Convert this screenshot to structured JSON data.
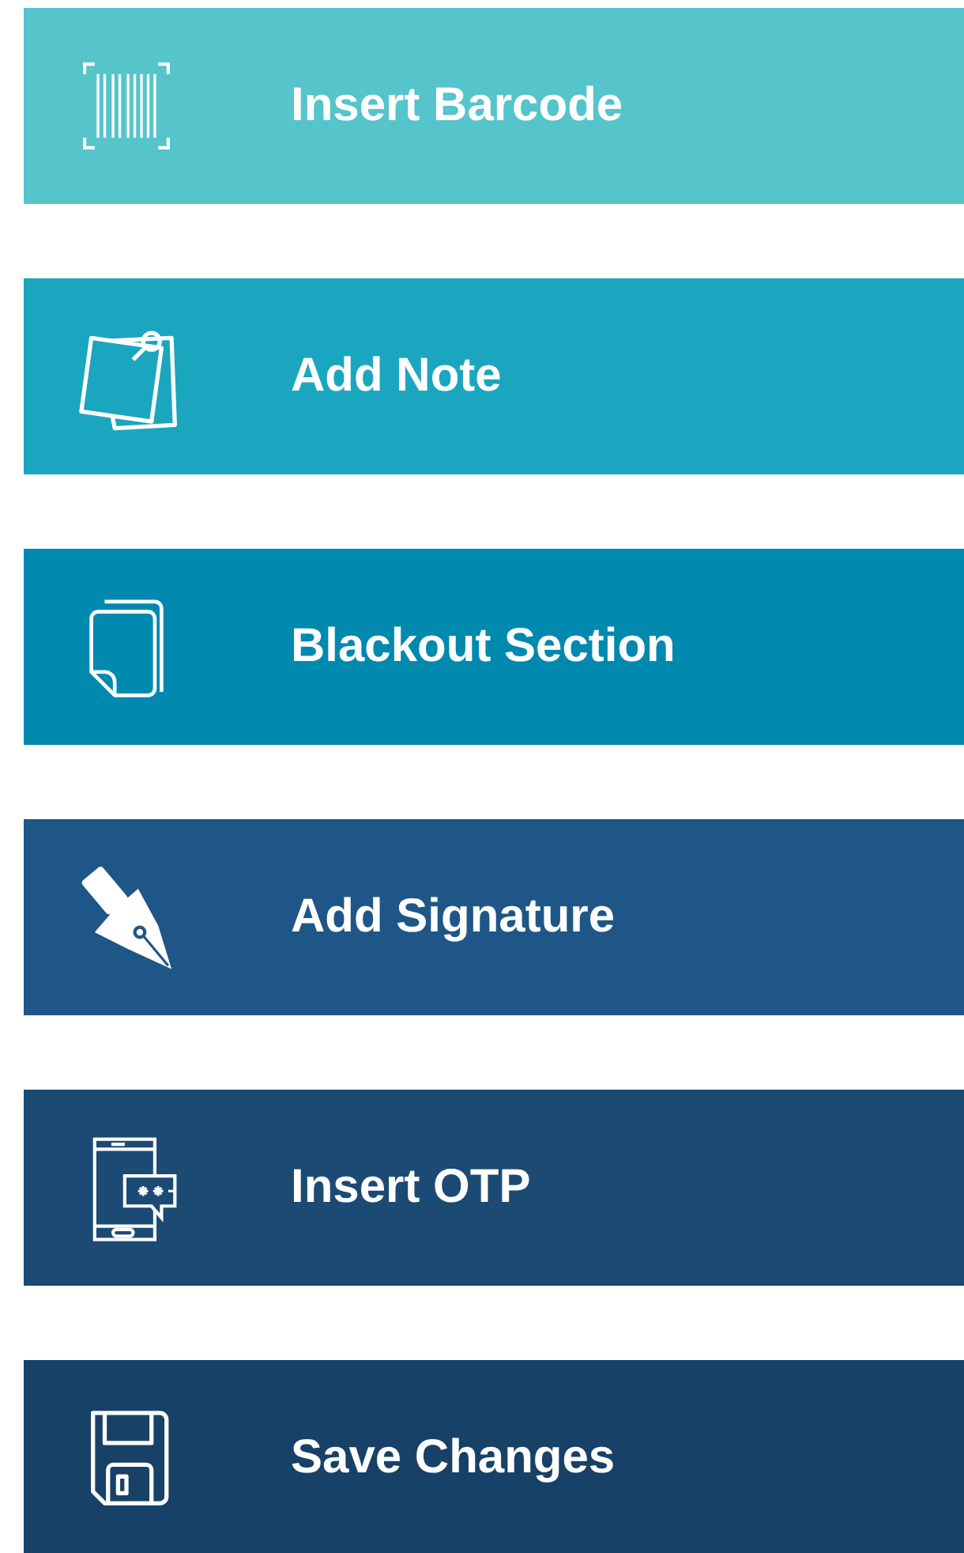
{
  "actions": [
    {
      "kind": "barcode",
      "label": "Insert Barcode",
      "color": "#55c4cb"
    },
    {
      "kind": "note",
      "label": "Add Note",
      "color": "#1ba6bf"
    },
    {
      "kind": "pages",
      "label": "Blackout Section",
      "color": "#0089ae"
    },
    {
      "kind": "pen",
      "label": "Add Signature",
      "color": "#1e5687"
    },
    {
      "kind": "otp",
      "label": "Insert OTP",
      "color": "#1b4a74"
    },
    {
      "kind": "save",
      "label": "Save Changes",
      "color": "#174167"
    }
  ]
}
